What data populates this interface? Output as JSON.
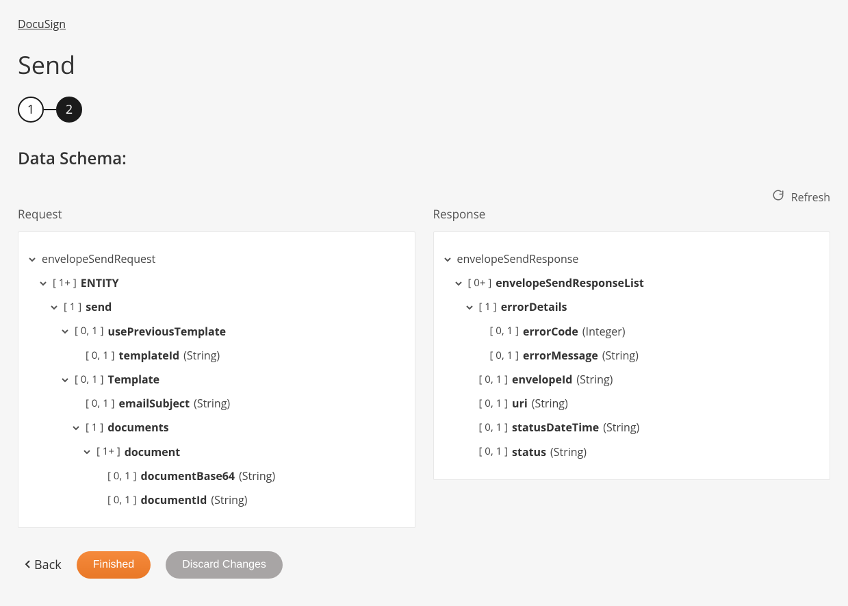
{
  "breadcrumb": {
    "label": "DocuSign"
  },
  "page": {
    "title": "Send"
  },
  "stepper": {
    "step1": "1",
    "step2": "2"
  },
  "section": {
    "title": "Data Schema:"
  },
  "refresh": {
    "label": "Refresh"
  },
  "columns": {
    "request_title": "Request",
    "response_title": "Response"
  },
  "request_tree": {
    "root": "envelopeSendRequest",
    "entity": {
      "card": "[ 1+ ]",
      "name": "ENTITY"
    },
    "send": {
      "card": "[ 1 ]",
      "name": "send"
    },
    "usePreviousTemplate": {
      "card": "[ 0, 1 ]",
      "name": "usePreviousTemplate"
    },
    "templateId": {
      "card": "[ 0, 1 ]",
      "name": "templateId",
      "type": "(String)"
    },
    "template": {
      "card": "[ 0, 1 ]",
      "name": "Template"
    },
    "emailSubject": {
      "card": "[ 0, 1 ]",
      "name": "emailSubject",
      "type": "(String)"
    },
    "documents": {
      "card": "[ 1 ]",
      "name": "documents"
    },
    "document": {
      "card": "[ 1+ ]",
      "name": "document"
    },
    "documentBase64": {
      "card": "[ 0, 1 ]",
      "name": "documentBase64",
      "type": "(String)"
    },
    "documentId": {
      "card": "[ 0, 1 ]",
      "name": "documentId",
      "type": "(String)"
    }
  },
  "response_tree": {
    "root": "envelopeSendResponse",
    "list": {
      "card": "[ 0+ ]",
      "name": "envelopeSendResponseList"
    },
    "errorDetails": {
      "card": "[ 1 ]",
      "name": "errorDetails"
    },
    "errorCode": {
      "card": "[ 0, 1 ]",
      "name": "errorCode",
      "type": "(Integer)"
    },
    "errorMessage": {
      "card": "[ 0, 1 ]",
      "name": "errorMessage",
      "type": "(String)"
    },
    "envelopeId": {
      "card": "[ 0, 1 ]",
      "name": "envelopeId",
      "type": "(String)"
    },
    "uri": {
      "card": "[ 0, 1 ]",
      "name": "uri",
      "type": "(String)"
    },
    "statusDateTime": {
      "card": "[ 0, 1 ]",
      "name": "statusDateTime",
      "type": "(String)"
    },
    "status": {
      "card": "[ 0, 1 ]",
      "name": "status",
      "type": "(String)"
    }
  },
  "footer": {
    "back": "Back",
    "finished": "Finished",
    "discard": "Discard Changes"
  }
}
